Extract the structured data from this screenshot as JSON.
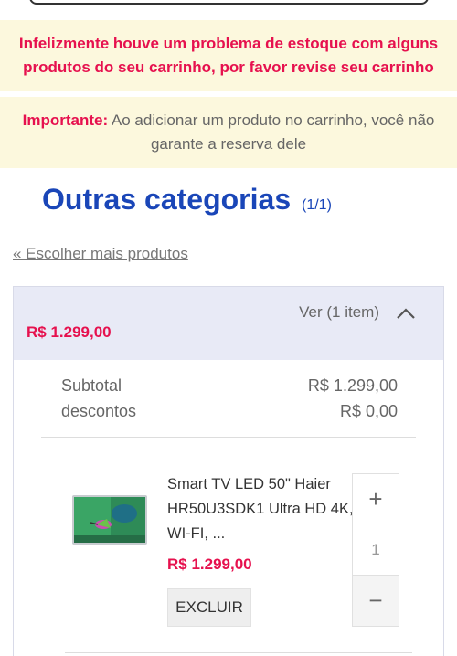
{
  "alerts": {
    "error": "Infelizmente houve um problema de estoque com alguns produtos do seu carrinho, por favor revise seu carrinho",
    "info_strong": "Importante:",
    "info_text": " Ao adicionar um produto no carrinho, você não garante a reserva dele"
  },
  "category": {
    "title": "Outras categorias",
    "count": "(1/1)",
    "back_link": "« Escolher mais produtos"
  },
  "cart": {
    "toggle_label": "Ver (1 item)",
    "toggle_icon": "chevron-up-icon",
    "header_price": "R$ 1.299,00",
    "summary": {
      "subtotal_label": "Subtotal",
      "subtotal_value": "R$ 1.299,00",
      "discount_label": "descontos",
      "discount_value": "R$ 0,00"
    },
    "item": {
      "name": "Smart TV LED 50\" Haier HR50U3SDK1 Ultra HD 4K, WI-FI, ...",
      "price": "R$ 1.299,00",
      "delete_label": "EXCLUIR",
      "plus": "+",
      "quantity": "1",
      "minus": "−"
    }
  },
  "colors": {
    "accent_red": "#e6114e",
    "brand_blue": "#1a46b8",
    "alert_bg": "#fcf8dd"
  }
}
